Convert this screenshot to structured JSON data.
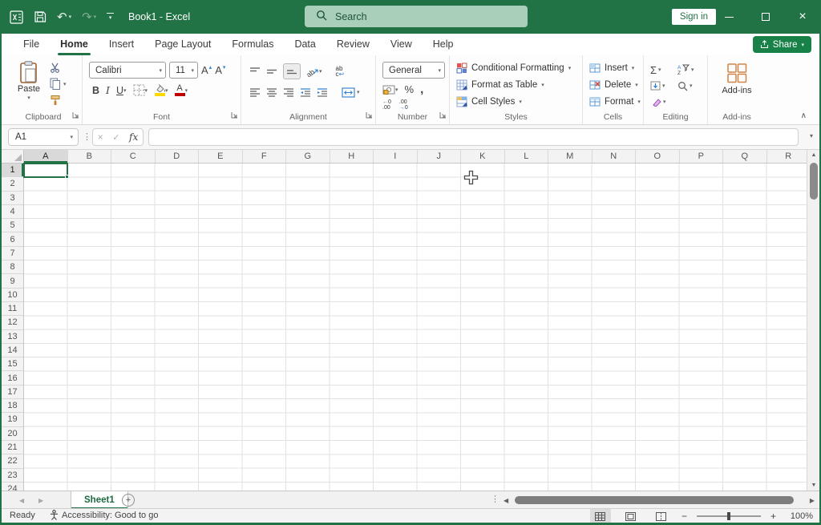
{
  "colors": {
    "brand_green": "#217346",
    "search_bg": "#a9cfba",
    "fill_yellow": "#ffd800",
    "font_color_red": "#c00000"
  },
  "titlebar": {
    "title": "Book1 - Excel",
    "search_placeholder": "Search",
    "sign_in_label": "Sign in"
  },
  "icons": {
    "undo": "↶",
    "redo": "↷",
    "chevron_down": "▾",
    "collapse_ribbon": "∧",
    "close": "×",
    "dots": "⋮",
    "left_arrow": "◀",
    "right_arrow": "▶",
    "up_arrow": "▲",
    "down_arrow": "▼",
    "wrap_return": "↩",
    "merge_arrows": "↔",
    "check": "✓",
    "cancel": "×",
    "plus": "+",
    "minus": "−",
    "grow_mark": "▴",
    "shrink_mark": "▾",
    "arrow_left": "←",
    "arrow_right": "→"
  },
  "tabs": {
    "items": [
      "File",
      "Home",
      "Insert",
      "Page Layout",
      "Formulas",
      "Data",
      "Review",
      "View",
      "Help"
    ],
    "active": "Home"
  },
  "share": {
    "label": "Share"
  },
  "ribbon": {
    "clipboard": {
      "label": "Clipboard",
      "paste_label": "Paste"
    },
    "font": {
      "label": "Font",
      "font_name": "Calibri",
      "font_size": "11",
      "bold": "B",
      "italic": "I",
      "underline": "U",
      "grow": "A",
      "shrink": "A",
      "color_letter": "A"
    },
    "alignment": {
      "label": "Alignment",
      "wrap_ab": "ab",
      "wrap_c": "c"
    },
    "number": {
      "label": "Number",
      "format": "General",
      "percent": "%",
      "comma": ",",
      "zero": "0",
      "decimals": ".00"
    },
    "styles": {
      "label": "Styles",
      "conditional": "Conditional Formatting",
      "format_table": "Format as Table",
      "cell_styles": "Cell Styles"
    },
    "cells": {
      "label": "Cells",
      "insert": "Insert",
      "delete": "Delete",
      "format": "Format"
    },
    "editing": {
      "label": "Editing",
      "autosum": "Σ",
      "sort_a": "A",
      "sort_z": "Z"
    },
    "addins": {
      "label": "Add-ins",
      "button_label": "Add-ins"
    }
  },
  "formula_bar": {
    "name_box": "A1",
    "fx": "fx"
  },
  "grid": {
    "columns": [
      "A",
      "B",
      "C",
      "D",
      "E",
      "F",
      "G",
      "H",
      "I",
      "J",
      "K",
      "L",
      "M",
      "N",
      "O",
      "P",
      "Q",
      "R"
    ],
    "row_count": 24,
    "selected_cell": "A1",
    "selected_column": "A",
    "selected_row": 1
  },
  "sheet_bar": {
    "sheet_tabs": [
      {
        "name": "Sheet1",
        "active": true
      }
    ]
  },
  "status_bar": {
    "ready": "Ready",
    "accessibility": "Accessibility: Good to go",
    "zoom_level": "100%"
  }
}
